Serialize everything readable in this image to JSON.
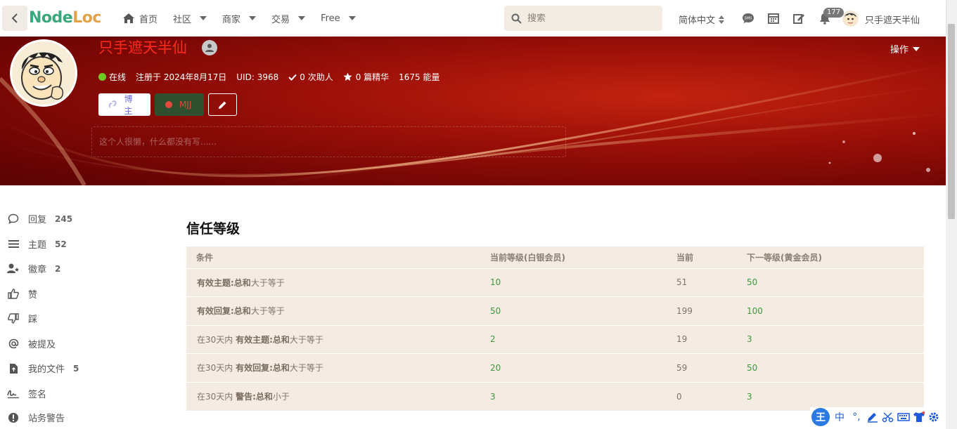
{
  "header": {
    "logo_part1": "Node",
    "logo_part2": "Loc",
    "nav": [
      {
        "label": "首页"
      },
      {
        "label": "社区"
      },
      {
        "label": "商家"
      },
      {
        "label": "交易"
      },
      {
        "label": "Free"
      }
    ],
    "search_placeholder": "搜索",
    "language": "简体中文",
    "notification_count": "177",
    "username": "只手遮天半仙"
  },
  "profile": {
    "name": "只手遮天半仙",
    "actions_label": "操作",
    "status": "在线",
    "registered": "注册于 2024年8月17日",
    "uid": "UID: 3968",
    "helped": "0 次助人",
    "essence": "0 篇精华",
    "energy": "1675 能量",
    "badge_blogger": "博主",
    "badge_mjj": "MJJ",
    "bio_placeholder": "这个人很懒，什么都没有写......"
  },
  "sidebar": {
    "items": [
      {
        "label": "回复",
        "count": "245",
        "icon": "comment-icon"
      },
      {
        "label": "主题",
        "count": "52",
        "icon": "list-icon"
      },
      {
        "label": "徽章",
        "count": "2",
        "icon": "user-badge-icon"
      },
      {
        "label": "赞",
        "count": "",
        "icon": "thumbs-up-icon"
      },
      {
        "label": "踩",
        "count": "",
        "icon": "thumbs-down-icon"
      },
      {
        "label": "被提及",
        "count": "",
        "icon": "at-icon"
      },
      {
        "label": "我的文件",
        "count": "5",
        "icon": "file-icon"
      },
      {
        "label": "签名",
        "count": "",
        "icon": "signature-icon"
      },
      {
        "label": "站务警告",
        "count": "",
        "icon": "warning-icon"
      }
    ]
  },
  "trust": {
    "title": "信任等级",
    "headers": [
      "条件",
      "当前等级(白银会员)",
      "当前",
      "下一等级(黄金会员)"
    ],
    "rows": [
      {
        "prefix": "",
        "bold": "有效主题:总和",
        "suffix": "大于等于",
        "level": "10",
        "current": "51",
        "next": "50"
      },
      {
        "prefix": "",
        "bold": "有效回复:总和",
        "suffix": "大于等于",
        "level": "50",
        "current": "199",
        "next": "100"
      },
      {
        "prefix": "在30天内 ",
        "bold": "有效主题:总和",
        "suffix": "大于等于",
        "level": "2",
        "current": "19",
        "next": "3"
      },
      {
        "prefix": "在30天内 ",
        "bold": "有效回复:总和",
        "suffix": "大于等于",
        "level": "20",
        "current": "59",
        "next": "50"
      },
      {
        "prefix": "在30天内 ",
        "bold": "警告:总和",
        "suffix": "小于",
        "level": "3",
        "current": "0",
        "next": "3"
      }
    ]
  },
  "ime": {
    "logo": "王",
    "mode": "中",
    "punct": "°,"
  }
}
